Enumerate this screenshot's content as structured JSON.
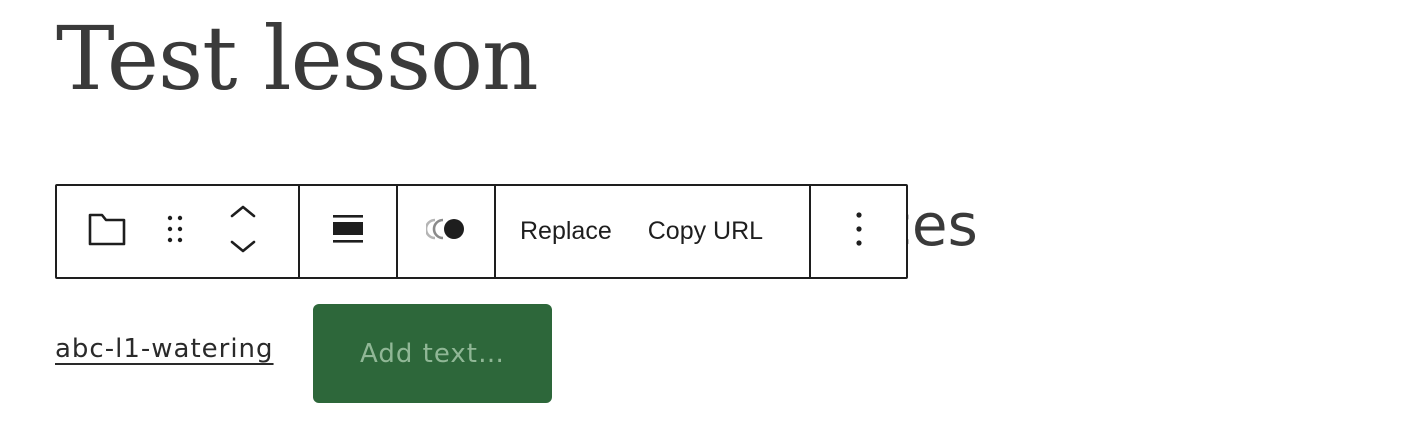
{
  "post": {
    "title": "Test lesson",
    "hidden_heading_fragment": "ces"
  },
  "toolbar": {
    "items": [
      {
        "icon": "folder-icon"
      },
      {
        "icon": "drag-handle-icon"
      },
      {
        "icon": "move-up-down-icon"
      },
      {
        "icon": "align-icon"
      },
      {
        "icon": "toggle-style-icon"
      },
      {
        "label": "Replace"
      },
      {
        "label": "Copy URL"
      },
      {
        "icon": "more-options-icon"
      }
    ],
    "replace_label": "Replace",
    "copy_url_label": "Copy URL"
  },
  "file_block": {
    "file_name": "abc-l1-watering",
    "button_placeholder": "Add text…"
  },
  "colors": {
    "text": "#3a3a3a",
    "toolbar_border": "#1e1e1e",
    "button_bg": "#2d673a",
    "button_placeholder": "#90b796"
  }
}
